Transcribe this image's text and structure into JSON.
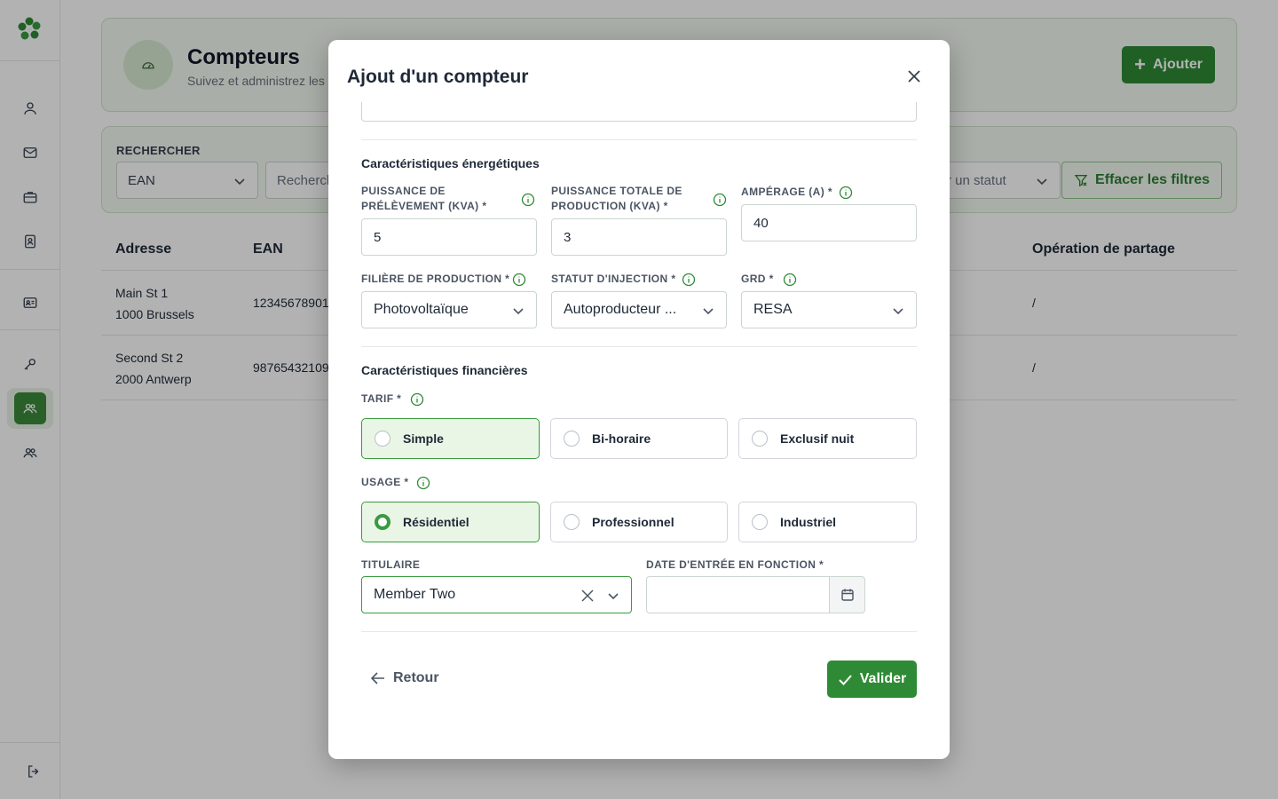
{
  "app": {
    "colors": {
      "accent": "#2f8a35",
      "accent_light": "#e9f6e6",
      "header_bg": "#f3f9f1"
    }
  },
  "sidebar": {
    "icons": [
      "logo-icon",
      "user-icon",
      "mail-icon",
      "briefcase-icon",
      "contact-icon",
      "id-card-icon",
      "key-icon",
      "users-icon",
      "group-icon",
      "logout-icon"
    ],
    "active": "users-icon"
  },
  "header": {
    "title": "Compteurs",
    "subtitle": "Suivez et administrez les c",
    "add_label": "Ajouter"
  },
  "filters": {
    "search_label": "RECHERCHER",
    "field_value": "EAN",
    "search_placeholder": "Recherch",
    "status_placeholder": "r un statut",
    "clear_label": "Effacer les filtres"
  },
  "table": {
    "columns": [
      "Adresse",
      "EAN",
      "Opération de partage"
    ],
    "rows": [
      {
        "address_line1": "Main St 1",
        "address_line2": "1000 Brussels",
        "ean": "12345678901",
        "sharing": "/"
      },
      {
        "address_line1": "Second St 2",
        "address_line2": "2000 Antwerp",
        "ean": "98765432109",
        "sharing": "/"
      }
    ]
  },
  "modal": {
    "title": "Ajout d'un compteur",
    "energy_section": "Caractéristiques énergétiques",
    "fields": {
      "puissance_prelevement": {
        "label": "PUISSANCE DE PRÉLÈVEMENT (KVA) *",
        "value": "5"
      },
      "puissance_production": {
        "label": "PUISSANCE TOTALE DE PRODUCTION (KVA) *",
        "value": "3"
      },
      "amperage": {
        "label": "AMPÉRAGE (A) *",
        "value": "40"
      },
      "filiere": {
        "label": "FILIÈRE DE PRODUCTION *",
        "value": "Photovoltaïque"
      },
      "statut_injection": {
        "label": "STATUT D'INJECTION *",
        "value": "Autoproducteur ..."
      },
      "grd": {
        "label": "GRD *",
        "value": "RESA"
      }
    },
    "finance_section": "Caractéristiques financières",
    "tarif": {
      "label": "TARIF *",
      "options": [
        "Simple",
        "Bi-horaire",
        "Exclusif nuit"
      ],
      "selected": "Simple"
    },
    "usage": {
      "label": "USAGE *",
      "options": [
        "Résidentiel",
        "Professionnel",
        "Industriel"
      ],
      "selected": "Résidentiel"
    },
    "titulaire": {
      "label": "TITULAIRE",
      "value": "Member Two"
    },
    "date_entree": {
      "label": "DATE D'ENTRÉE EN FONCTION *",
      "value": ""
    },
    "back_label": "Retour",
    "validate_label": "Valider"
  }
}
